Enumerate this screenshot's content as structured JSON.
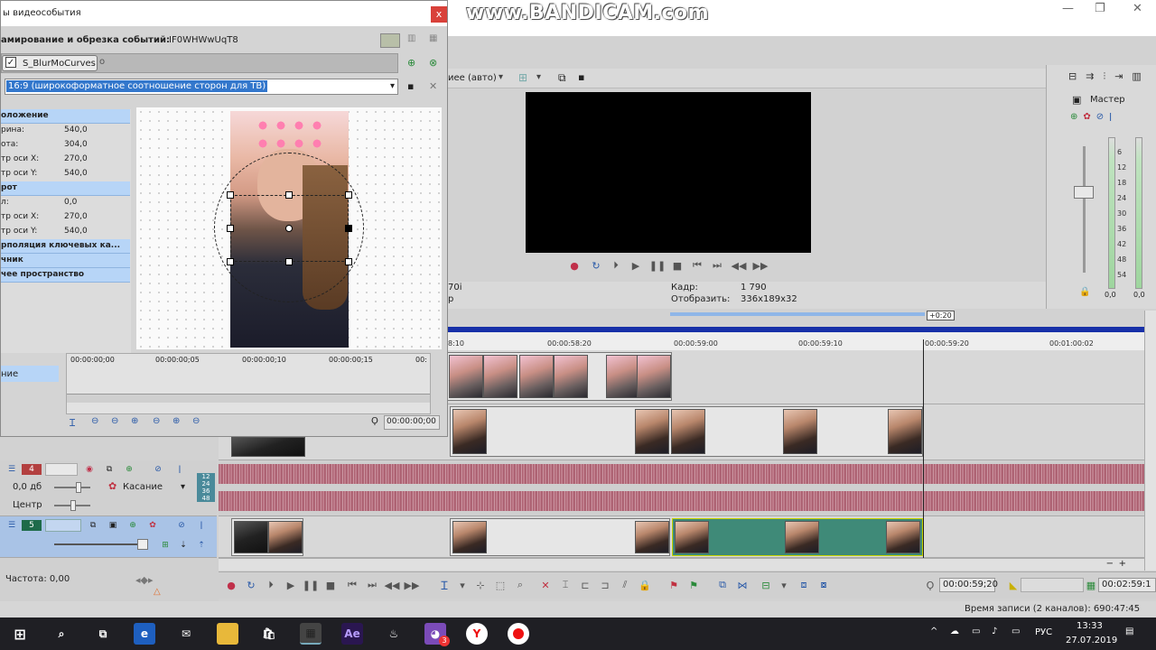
{
  "watermark": "www.BANDICAM.com",
  "window_controls": {
    "minimize": "—",
    "restore": "❐",
    "close": "✕"
  },
  "preview": {
    "quality_label": "иее (авто)",
    "frame_label": "Кадр:",
    "frame_value": "1 790",
    "display_label": "Отобразить:",
    "display_value": "336x189x32",
    "left_value_1": "70i",
    "left_value_2": "р"
  },
  "mixer": {
    "title": "Мастер",
    "scale": [
      "6",
      "12",
      "18",
      "24",
      "30",
      "36",
      "42",
      "48",
      "54"
    ],
    "readout_left": "0,0",
    "readout_right": "0,0"
  },
  "timeline": {
    "marker": "+0:20",
    "ticks": [
      "8:10",
      "00:00:58:20",
      "00:00:59:00",
      "00:00:59:10",
      "00:00:59:20",
      "00:01:00:02"
    ],
    "audio_track": {
      "number": "4",
      "volume": "0,0 дб",
      "mode": "Касание",
      "pan": "Центр"
    },
    "video_track": {
      "number": "5"
    },
    "mini_meter": [
      "12",
      "24",
      "36",
      "48"
    ]
  },
  "bottom": {
    "rate": "Частота: 0,00",
    "timecode": "00:00:59;20",
    "end_timecode": "00:02:59:1",
    "record_time": "Время записи (2 каналов): 690:47:45"
  },
  "dialog": {
    "title": "ы видеособытия",
    "close": "x",
    "crop_label": "амирование и обрезка событий:",
    "crop_id": "IF0WHWwUqT8",
    "plugin": "S_BlurMoCurves",
    "aspect": "16:9 (широкоформатное соотношение сторон для ТВ)",
    "props": [
      {
        "type": "header",
        "label": "оложение"
      },
      {
        "type": "item",
        "label": "рина:",
        "value": "540,0"
      },
      {
        "type": "item",
        "label": "ота:",
        "value": "304,0"
      },
      {
        "type": "item",
        "label": "тр оси X:",
        "value": "270,0"
      },
      {
        "type": "item",
        "label": "тр оси Y:",
        "value": "540,0"
      },
      {
        "type": "header",
        "label": "рот"
      },
      {
        "type": "item",
        "label": "л:",
        "value": "0,0"
      },
      {
        "type": "item",
        "label": "тр оси X:",
        "value": "270,0"
      },
      {
        "type": "item",
        "label": "тр оси Y:",
        "value": "540,0"
      },
      {
        "type": "header",
        "label": "рполяция ключевых ка..."
      },
      {
        "type": "header",
        "label": "чник"
      },
      {
        "type": "header",
        "label": "чее пространство"
      }
    ],
    "side_label": "ние",
    "timeline_ticks": [
      "00:00:00;00",
      "00:00:00;05",
      "00:00:00;10",
      "00:00:00;15",
      "00:"
    ],
    "time_value": "00:00:00;00"
  },
  "taskbar": {
    "language": "РУС",
    "time": "13:33",
    "date": "27.07.2019",
    "badge": "3",
    "ae_label": "Ae"
  }
}
